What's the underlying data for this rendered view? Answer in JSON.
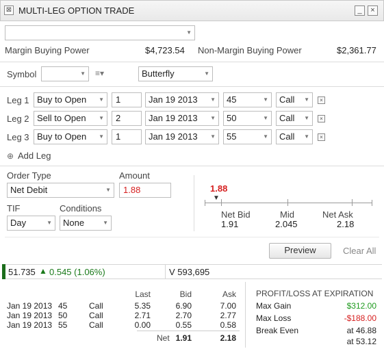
{
  "window": {
    "title": "MULTI-LEG OPTION TRADE",
    "icon": "option-trade-icon",
    "minimize_label": "_",
    "close_label": "×"
  },
  "account": {
    "selected": ""
  },
  "buying_power": {
    "margin_label": "Margin Buying Power",
    "margin_value": "$4,723.54",
    "non_margin_label": "Non-Margin Buying Power",
    "non_margin_value": "$2,361.77"
  },
  "symbol": {
    "label": "Symbol",
    "value": "",
    "strategy": "Butterfly"
  },
  "legs": [
    {
      "label": "Leg 1",
      "action": "Buy to Open",
      "qty": "1",
      "expiry": "Jan 19 2013",
      "strike": "45",
      "type": "Call"
    },
    {
      "label": "Leg 2",
      "action": "Sell to Open",
      "qty": "2",
      "expiry": "Jan 19 2013",
      "strike": "50",
      "type": "Call"
    },
    {
      "label": "Leg 3",
      "action": "Buy to Open",
      "qty": "1",
      "expiry": "Jan 19 2013",
      "strike": "55",
      "type": "Call"
    }
  ],
  "add_leg_label": "Add Leg",
  "order": {
    "order_type_label": "Order Type",
    "order_type": "Net Debit",
    "amount_label": "Amount",
    "amount": "1.88",
    "tif_label": "TIF",
    "tif": "Day",
    "conditions_label": "Conditions",
    "conditions": "None"
  },
  "price_scale": {
    "marker_value": "1.88",
    "net_bid_label": "Net Bid",
    "net_bid": "1.91",
    "mid_label": "Mid",
    "mid": "2.045",
    "net_ask_label": "Net Ask",
    "net_ask": "2.18"
  },
  "buttons": {
    "preview": "Preview",
    "clear_all": "Clear All"
  },
  "quote": {
    "last": "51.735",
    "change": "0.545 (1.06%)",
    "volume": "V 593,695"
  },
  "leg_quotes": {
    "headers": {
      "last": "Last",
      "bid": "Bid",
      "ask": "Ask"
    },
    "rows": [
      {
        "expiry": "Jan 19 2013",
        "strike": "45",
        "type": "Call",
        "last": "5.35",
        "bid": "6.90",
        "ask": "7.00"
      },
      {
        "expiry": "Jan 19 2013",
        "strike": "50",
        "type": "Call",
        "last": "2.71",
        "bid": "2.70",
        "ask": "2.77"
      },
      {
        "expiry": "Jan 19 2013",
        "strike": "55",
        "type": "Call",
        "last": "0.00",
        "bid": "0.55",
        "ask": "0.58"
      }
    ],
    "net_label": "Net",
    "net_bid": "1.91",
    "net_ask": "2.18"
  },
  "pnl": {
    "title": "PROFIT/LOSS AT EXPIRATION",
    "max_gain_label": "Max Gain",
    "max_gain": "$312.00",
    "max_loss_label": "Max Loss",
    "max_loss": "-$188.00",
    "break_even_label": "Break Even",
    "break_even_1": "at 46.88",
    "break_even_2": "at 53.12"
  },
  "colors": {
    "accent_red": "#d62020",
    "gain_green": "#1e9a1e",
    "quote_green": "#1b7a1b"
  }
}
